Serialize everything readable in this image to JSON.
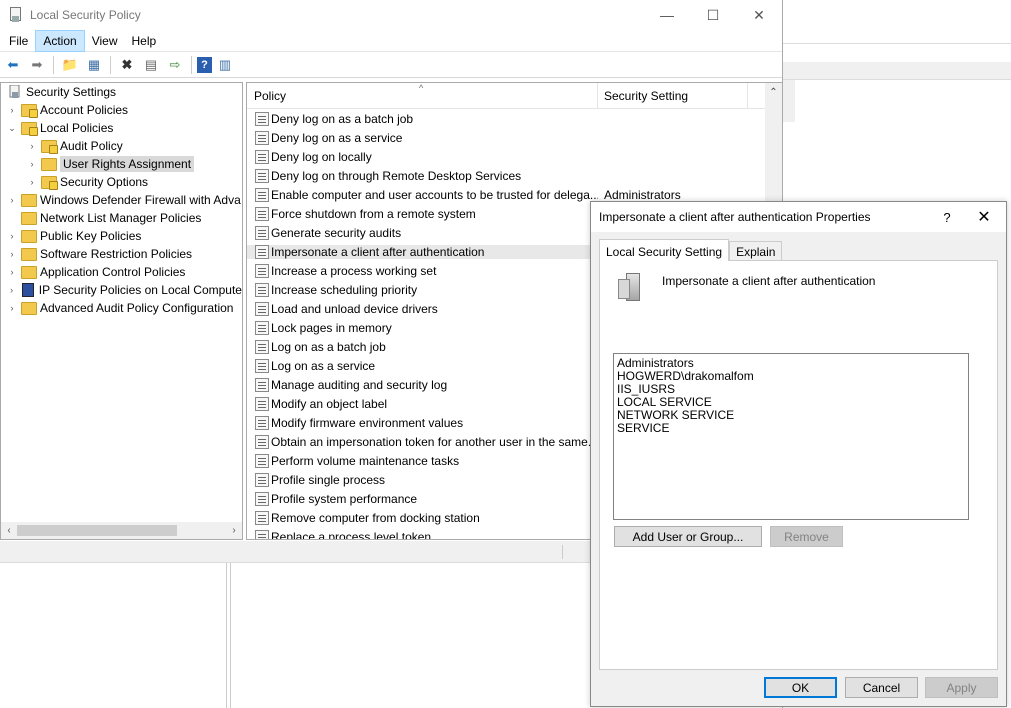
{
  "window": {
    "title": "Local Security Policy",
    "minimize": "—",
    "maximize": "☐",
    "close": "✕"
  },
  "menu": [
    "File",
    "Action",
    "View",
    "Help"
  ],
  "tree": {
    "root": "Security Settings",
    "items": [
      {
        "label": "Account Policies",
        "level": 1,
        "expander": "›",
        "lock": true
      },
      {
        "label": "Local Policies",
        "level": 1,
        "expander": "⌄",
        "lock": true
      },
      {
        "label": "Audit Policy",
        "level": 2,
        "expander": "›",
        "lock": true
      },
      {
        "label": "User Rights Assignment",
        "level": 2,
        "expander": "›",
        "lock": false,
        "selected": true
      },
      {
        "label": "Security Options",
        "level": 2,
        "expander": "›",
        "lock": true
      },
      {
        "label": "Windows Defender Firewall with Adva",
        "level": 1,
        "expander": "›",
        "lock": false
      },
      {
        "label": "Network List Manager Policies",
        "level": 1,
        "expander": "",
        "lock": false
      },
      {
        "label": "Public Key Policies",
        "level": 1,
        "expander": "›",
        "lock": false
      },
      {
        "label": "Software Restriction Policies",
        "level": 1,
        "expander": "›",
        "lock": false
      },
      {
        "label": "Application Control Policies",
        "level": 1,
        "expander": "›",
        "lock": false
      },
      {
        "label": "IP Security Policies on Local Compute",
        "level": 1,
        "expander": "›",
        "lock": false,
        "special": true
      },
      {
        "label": "Advanced Audit Policy Configuration",
        "level": 1,
        "expander": "›",
        "lock": false
      }
    ]
  },
  "list": {
    "col_policy": "Policy",
    "col_setting": "Security Setting",
    "rows": [
      {
        "policy": "Deny log on as a batch job",
        "setting": ""
      },
      {
        "policy": "Deny log on as a service",
        "setting": ""
      },
      {
        "policy": "Deny log on locally",
        "setting": ""
      },
      {
        "policy": "Deny log on through Remote Desktop Services",
        "setting": ""
      },
      {
        "policy": "Enable computer and user accounts to be trusted for delega...",
        "setting": "Administrators"
      },
      {
        "policy": "Force shutdown from a remote system",
        "setting": ""
      },
      {
        "policy": "Generate security audits",
        "setting": ""
      },
      {
        "policy": "Impersonate a client after authentication",
        "setting": "",
        "selected": true
      },
      {
        "policy": "Increase a process working set",
        "setting": ""
      },
      {
        "policy": "Increase scheduling priority",
        "setting": ""
      },
      {
        "policy": "Load and unload device drivers",
        "setting": ""
      },
      {
        "policy": "Lock pages in memory",
        "setting": ""
      },
      {
        "policy": "Log on as a batch job",
        "setting": ""
      },
      {
        "policy": "Log on as a service",
        "setting": ""
      },
      {
        "policy": "Manage auditing and security log",
        "setting": ""
      },
      {
        "policy": "Modify an object label",
        "setting": ""
      },
      {
        "policy": "Modify firmware environment values",
        "setting": ""
      },
      {
        "policy": "Obtain an impersonation token for another user in the same...",
        "setting": ""
      },
      {
        "policy": "Perform volume maintenance tasks",
        "setting": ""
      },
      {
        "policy": "Profile single process",
        "setting": ""
      },
      {
        "policy": "Profile system performance",
        "setting": ""
      },
      {
        "policy": "Remove computer from docking station",
        "setting": ""
      },
      {
        "policy": "Replace a process level token",
        "setting": ""
      }
    ]
  },
  "dialog": {
    "title": "Impersonate a client after authentication Properties",
    "help": "?",
    "close": "✕",
    "tabs": [
      "Local Security Setting",
      "Explain"
    ],
    "policy_name": "Impersonate a client after authentication",
    "members": [
      "Administrators",
      "HOGWERD\\drakomalfom",
      "IIS_IUSRS",
      "LOCAL SERVICE",
      "NETWORK SERVICE",
      "SERVICE"
    ],
    "add_button": "Add User or Group...",
    "remove_button": "Remove",
    "ok": "OK",
    "cancel": "Cancel",
    "apply": "Apply"
  }
}
